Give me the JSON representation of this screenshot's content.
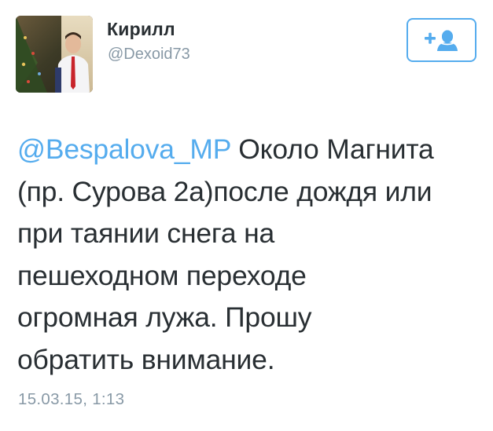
{
  "user": {
    "display_name": "Кирилл",
    "handle": "@Dexoid73"
  },
  "follow_button": {
    "icon": "add-user-icon",
    "color": "#55acee"
  },
  "tweet": {
    "mention": "@Bespalova_MP",
    "lines": [
      " Около Магнита",
      "(пр. Сурова 2а)после дождя или",
      "при таянии снега на",
      "пешеходном переходе",
      "огромная лужа. Прошу",
      "обратить внимание."
    ],
    "timestamp": "15.03.15, 1:13"
  },
  "colors": {
    "link": "#55acee",
    "text": "#292f33",
    "secondary": "#8899a6"
  }
}
